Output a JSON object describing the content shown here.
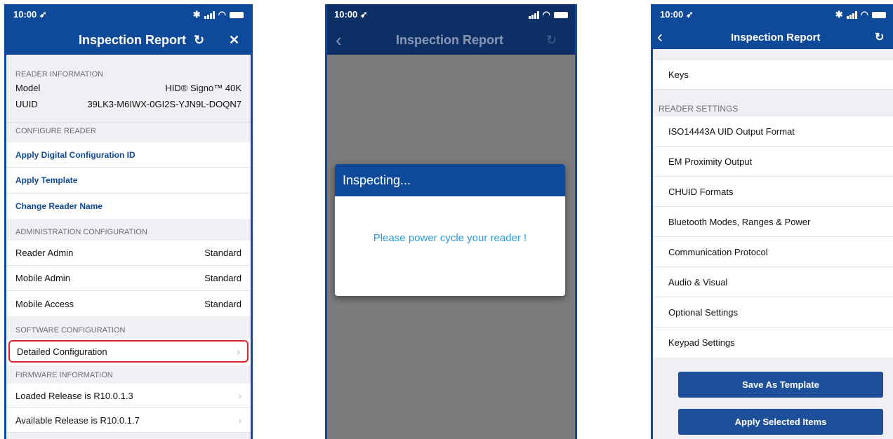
{
  "screen1": {
    "time": "10:00",
    "title": "Inspection Report",
    "reader_info": {
      "header": "READER INFORMATION",
      "model_label": "Model",
      "model_value": "HID® Signo™ 40K",
      "uuid_label": "UUID",
      "uuid_value": "39LK3-M6IWX-0GI2S-YJN9L-DOQN7"
    },
    "configure": {
      "header": "CONFIGURE READER",
      "items": [
        "Apply Digital Configuration ID",
        "Apply Template",
        "Change Reader Name"
      ]
    },
    "admin": {
      "header": "ADMINISTRATION CONFIGURATION",
      "rows": [
        {
          "label": "Reader Admin",
          "value": "Standard"
        },
        {
          "label": "Mobile Admin",
          "value": "Standard"
        },
        {
          "label": "Mobile Access",
          "value": "Standard"
        }
      ]
    },
    "software": {
      "header": "SOFTWARE CONFIGURATION",
      "item": "Detailed Configuration"
    },
    "firmware": {
      "header": "FIRMWARE INFORMATION",
      "items": [
        "Loaded Release is R10.0.1.3",
        "Available Release is R10.0.1.7"
      ]
    },
    "highlight_color": "#e0242f"
  },
  "screen2": {
    "time": "10:00",
    "title": "Inspection Report",
    "dialog_title": "Inspecting...",
    "dialog_message": "Please power cycle your reader !",
    "message_color": "#2a9ad6"
  },
  "screen3": {
    "time": "10:00",
    "title": "Inspection Report",
    "top_item": "Keys",
    "section_header": "READER SETTINGS",
    "items": [
      "ISO14443A UID Output Format",
      "EM Proximity Output",
      "CHUID Formats",
      "Bluetooth Modes, Ranges & Power",
      "Communication Protocol",
      "Audio & Visual",
      "Optional Settings",
      "Keypad Settings"
    ],
    "save_template": "Save As Template",
    "apply_selected": "Apply Selected Items"
  },
  "colors": {
    "brand": "#0f4a9a",
    "background": "#efeff4"
  }
}
